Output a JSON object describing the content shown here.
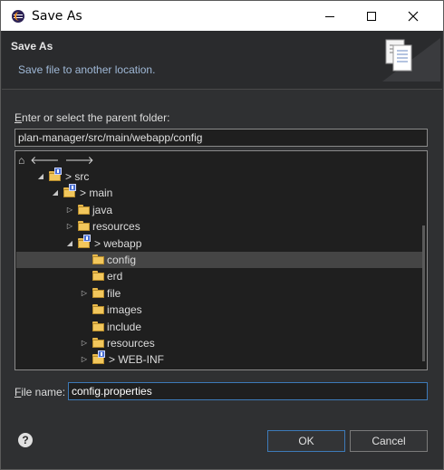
{
  "window": {
    "title": "Save As"
  },
  "header": {
    "title": "Save As",
    "description": "Save file to another location."
  },
  "folder_section": {
    "label_underlined": "E",
    "label_rest": "nter or select the parent folder:",
    "path_value": "plan-manager/src/main/webapp/config"
  },
  "tree": {
    "rows": [
      {
        "label": "> src",
        "depth": 0,
        "expanded": true,
        "project_badge": true
      },
      {
        "label": "> main",
        "depth": 1,
        "expanded": true,
        "project_badge": true
      },
      {
        "label": "java",
        "depth": 2,
        "expanded": false,
        "project_badge": false
      },
      {
        "label": "resources",
        "depth": 2,
        "expanded": false,
        "project_badge": false
      },
      {
        "label": "> webapp",
        "depth": 2,
        "expanded": true,
        "project_badge": true
      },
      {
        "label": "config",
        "depth": 3,
        "expanded": null,
        "project_badge": false,
        "selected": true
      },
      {
        "label": "erd",
        "depth": 3,
        "expanded": null,
        "project_badge": false
      },
      {
        "label": "file",
        "depth": 3,
        "expanded": false,
        "project_badge": false
      },
      {
        "label": "images",
        "depth": 3,
        "expanded": null,
        "project_badge": false
      },
      {
        "label": "include",
        "depth": 3,
        "expanded": null,
        "project_badge": false
      },
      {
        "label": "resources",
        "depth": 3,
        "expanded": false,
        "project_badge": false
      },
      {
        "label": "> WEB-INF",
        "depth": 3,
        "expanded": false,
        "project_badge": true
      }
    ]
  },
  "file_name": {
    "label_underlined": "F",
    "label_rest": "ile name:",
    "value": "config.properties"
  },
  "buttons": {
    "ok": "OK",
    "cancel": "Cancel"
  },
  "icons": {
    "help": "?"
  }
}
